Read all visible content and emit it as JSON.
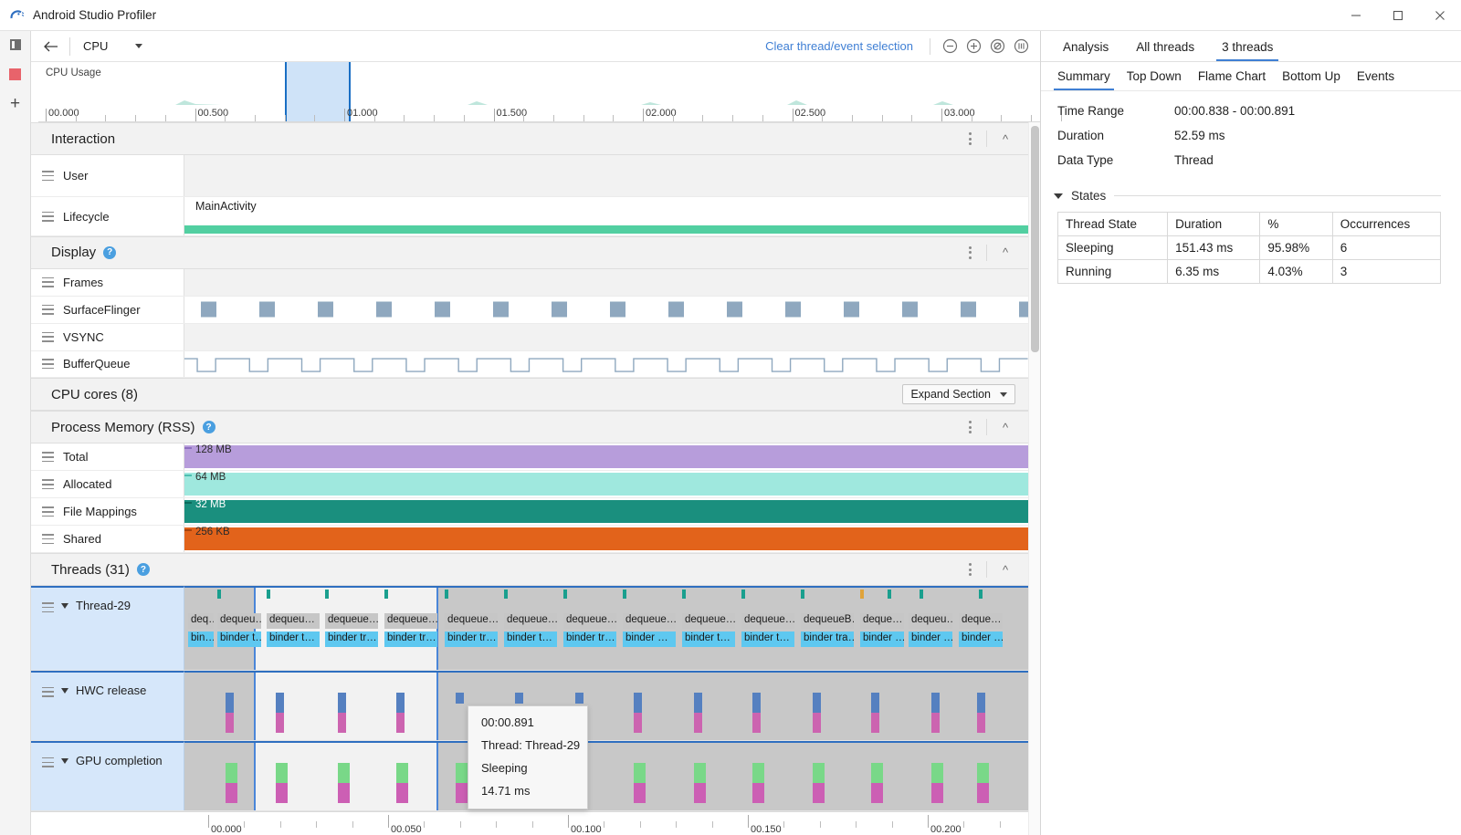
{
  "window": {
    "title": "Android Studio Profiler",
    "minimize_label": "–",
    "maximize_label": "□",
    "close_label": "✕"
  },
  "rail": {
    "panel_toggle_icon": "panel-toggle-icon",
    "stop_recording_icon": "stop-recording-icon",
    "add_icon": "plus-icon"
  },
  "toolbar": {
    "back_icon": "back-arrow-icon",
    "selector_value": "CPU",
    "clear_selection_label": "Clear thread/event selection",
    "zoom_out_label": "−",
    "zoom_in_label": "+",
    "reset_zoom_label": "reset-zoom",
    "attach_live_label": "attach-to-live"
  },
  "overview": {
    "label": "CPU Usage",
    "ticks": [
      "00.000",
      "00.500",
      "01.000",
      "01.500",
      "02.000",
      "02.500",
      "03.000"
    ],
    "selection_start": "00.838",
    "selection_end": "00.891"
  },
  "sections": {
    "interaction": {
      "title": "Interaction",
      "rows": [
        {
          "label": "User",
          "value": ""
        },
        {
          "label": "Lifecycle",
          "value": "MainActivity"
        }
      ]
    },
    "display": {
      "title": "Display",
      "help": "?",
      "rows": [
        {
          "label": "Frames"
        },
        {
          "label": "SurfaceFlinger"
        },
        {
          "label": "VSYNC"
        },
        {
          "label": "BufferQueue"
        }
      ]
    },
    "cpu_cores": {
      "title": "CPU cores (8)",
      "expand_label": "Expand Section"
    },
    "process_memory": {
      "title": "Process Memory (RSS)",
      "help": "?",
      "rows": [
        {
          "label": "Total",
          "value": "128 MB",
          "color": "#b79ddb"
        },
        {
          "label": "Allocated",
          "value": "64 MB",
          "color": "#9fe8de"
        },
        {
          "label": "File Mappings",
          "value": "32 MB",
          "color": "#1a8f7e"
        },
        {
          "label": "Shared",
          "value": "256 KB",
          "color": "#e2631b"
        }
      ]
    },
    "threads": {
      "title": "Threads (31)",
      "help": "?",
      "rows": [
        {
          "label": "Thread-29"
        },
        {
          "label": "HWC release"
        },
        {
          "label": "GPU completion"
        }
      ]
    }
  },
  "thread_traces": {
    "level1": [
      "deq…",
      "dequeu…",
      "dequeu…",
      "dequeue…",
      "dequeue…",
      "dequeue…",
      "dequeue…",
      "dequeue…",
      "dequeue…",
      "dequeue…",
      "dequeue…",
      "dequeueB…",
      "deque…",
      "dequeu…",
      "deque…"
    ],
    "level2": [
      "bin…",
      "binder t…",
      "binder t…",
      "binder tr…",
      "binder tr…",
      "binder tr…",
      "binder t…",
      "binder tr…",
      "binder …",
      "binder t…",
      "binder t…",
      "binder tra…",
      "binder …",
      "binder …",
      "binder …"
    ]
  },
  "bottom_ruler": {
    "ticks": [
      "00.000",
      "00.050",
      "00.100",
      "00.150",
      "00.200"
    ]
  },
  "tooltip": {
    "time": "00:00.891",
    "thread": "Thread: Thread-29",
    "state": "Sleeping",
    "duration": "14.71 ms"
  },
  "right_panel": {
    "tabs": [
      {
        "label": "Analysis",
        "active": false
      },
      {
        "label": "All threads",
        "active": false
      },
      {
        "label": "3 threads",
        "active": true
      }
    ],
    "subtabs": [
      {
        "label": "Summary",
        "active": true
      },
      {
        "label": "Top Down",
        "active": false
      },
      {
        "label": "Flame Chart",
        "active": false
      },
      {
        "label": "Bottom Up",
        "active": false
      },
      {
        "label": "Events",
        "active": false
      }
    ],
    "summary": [
      {
        "key": "Time Range",
        "value": "00:00.838 - 00:00.891"
      },
      {
        "key": "Duration",
        "value": "52.59 ms"
      },
      {
        "key": "Data Type",
        "value": "Thread"
      }
    ],
    "states_title": "States",
    "states_headers": [
      "Thread State",
      "Duration",
      "%",
      "Occurrences"
    ],
    "states_rows": [
      [
        "Sleeping",
        "151.43 ms",
        "95.98%",
        "6"
      ],
      [
        "Running",
        "6.35 ms",
        "4.03%",
        "3"
      ]
    ]
  },
  "colors": {
    "accent": "#3f7fd4",
    "selection_border": "#1a6fc4",
    "lifecycle_bar": "#52cfa1",
    "record_red": "#e8636b"
  }
}
